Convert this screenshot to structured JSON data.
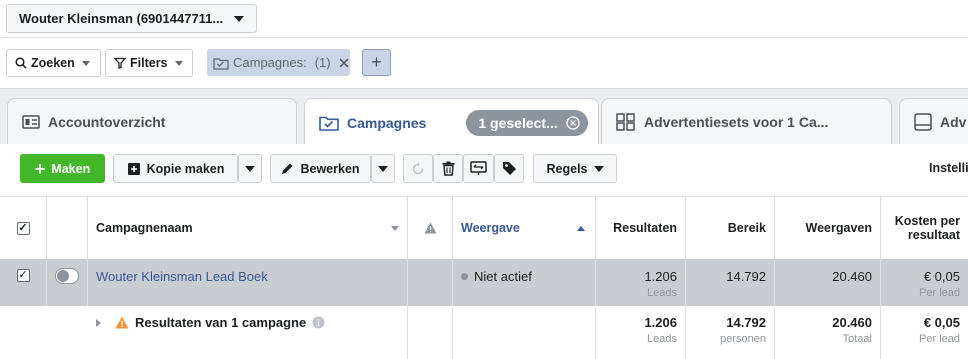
{
  "account": {
    "name": "Wouter Kleinsman (6901447711..."
  },
  "filterbar": {
    "search_label": "Zoeken",
    "filters_label": "Filters",
    "chip_label": "Campagnes:",
    "chip_count": "(1)",
    "add_label": "+"
  },
  "tabs": {
    "overview": "Accountoverzicht",
    "campaigns": "Campagnes",
    "selected_pill": "1 geselect...",
    "adsets": "Advertentiesets voor 1 Ca...",
    "ads": "Adv"
  },
  "toolbar": {
    "create_label": "Maken",
    "copy_label": "Kopie maken",
    "edit_label": "Bewerken",
    "rules_label": "Regels",
    "settings_label": "Instelli"
  },
  "table": {
    "headers": {
      "name": "Campagnenaam",
      "delivery": "Weergave",
      "results": "Resultaten",
      "reach": "Bereik",
      "impressions": "Weergaven",
      "cost_line1": "Kosten per",
      "cost_line2": "resultaat"
    },
    "row": {
      "name": "Wouter Kleinsman Lead Boek",
      "delivery": "Niet actief",
      "results": "1.206",
      "results_unit": "Leads",
      "reach": "14.792",
      "impressions": "20.460",
      "cost": "€ 0,05",
      "cost_unit": "Per lead"
    },
    "summary": {
      "label": "Resultaten van 1 campagne",
      "results": "1.206",
      "results_unit": "Leads",
      "reach": "14.792",
      "reach_unit": "personen",
      "impressions": "20.460",
      "impressions_unit": "Totaal",
      "cost": "€ 0,05",
      "cost_unit": "Per lead"
    }
  },
  "colors": {
    "accent": "#385898",
    "green": "#42b72a",
    "selected_row": "#c9ccd1",
    "warning": "#f7923b"
  }
}
